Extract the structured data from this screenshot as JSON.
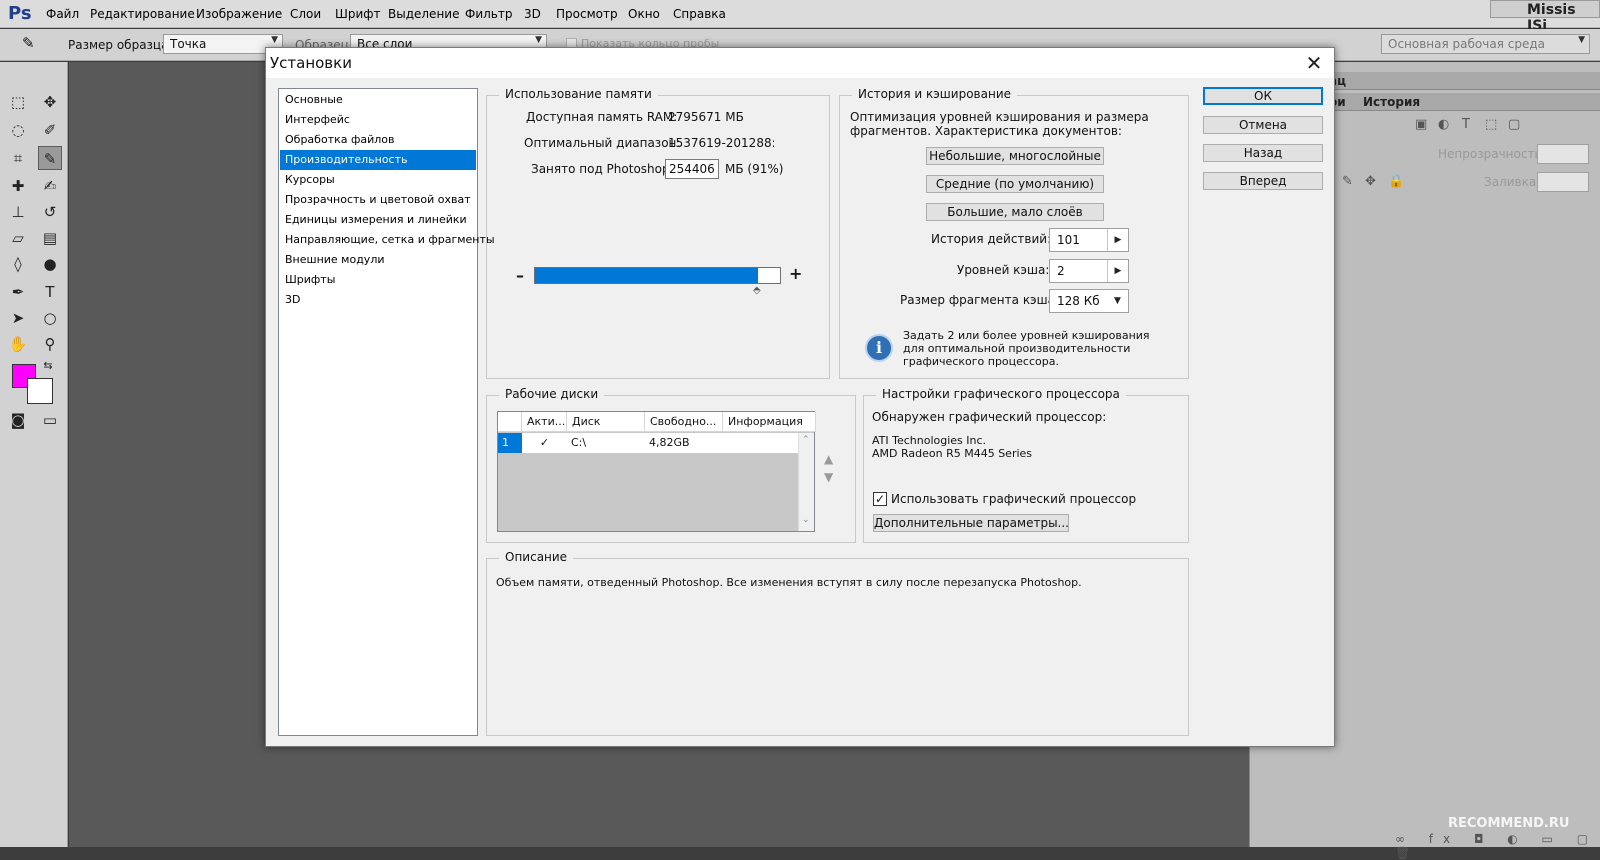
{
  "app": {
    "logo": "Ps",
    "user": "Missis JSi"
  },
  "menu": [
    "Файл",
    "Редактирование",
    "Изображение",
    "Слои",
    "Шрифт",
    "Выделение",
    "Фильтр",
    "3D",
    "Просмотр",
    "Окно",
    "Справка"
  ],
  "options_bar": {
    "sample_size_label": "Размер образца:",
    "sample_size_value": "Точка",
    "sample_label": "Образец:",
    "sample_value": "Все слои",
    "show_ring_label": "Показать кольцо пробы",
    "workspace": "Основная рабочая среда"
  },
  "right_panel": {
    "tab_top": "ац",
    "tab_active_partial": "ои",
    "tab_history": "История",
    "opacity_label": "Непрозрачность:",
    "fill_label": "Заливка:"
  },
  "colors": {
    "foreground": "#ff00ff",
    "background": "#ffffff",
    "selection": "#0078d7"
  },
  "dialog": {
    "title": "Установки",
    "nav": [
      "Основные",
      "Интерфейс",
      "Обработка файлов",
      "Производительность",
      "Курсоры",
      "Прозрачность и цветовой охват",
      "Единицы измерения и линейки",
      "Направляющие, сетка и фрагменты",
      "Внешние модули",
      "Шрифты",
      "3D"
    ],
    "nav_selected_index": 3,
    "buttons": {
      "ok": "ОК",
      "cancel": "Отмена",
      "back": "Назад",
      "forward": "Вперед"
    },
    "memory": {
      "title": "Использование памяти",
      "ram_label": "Доступная память RAM:",
      "ram_value": "2795671 МБ",
      "range_label": "Оптимальный диапазон:",
      "range_value": "1537619-201288:",
      "used_label": "Занято под Photoshop:",
      "used_value": "254406",
      "used_suffix": "МБ (91%)",
      "slider_fraction": 0.91,
      "minus": "–",
      "plus": "+"
    },
    "history_cache": {
      "title": "История и кэширование",
      "description": "Оптимизация уровней кэширования и размера фрагментов. Характеристика документов:",
      "preset_small": "Небольшие, многослойные",
      "preset_medium": "Средние (по умолчанию)",
      "preset_large": "Большие, мало слоёв",
      "history_label": "История действий:",
      "history_value": "101",
      "cache_levels_label": "Уровней кэша:",
      "cache_levels_value": "2",
      "tile_size_label": "Размер фрагмента кэша:",
      "tile_size_value": "128 Кб",
      "info_text": "Задать 2 или более уровней кэширования для оптимальной производительности графического процессора."
    },
    "scratch_disks": {
      "title": "Рабочие диски",
      "columns": [
        "Акти...",
        "Диск",
        "Свободно...",
        "Информация"
      ],
      "rows": [
        {
          "num": "1",
          "active": "✓",
          "disk": "C:\\",
          "free": "4,82GB",
          "info": ""
        }
      ]
    },
    "gpu": {
      "title": "Настройки графического процессора",
      "detected_label": "Обнаружен графический процессор:",
      "vendor": "ATI Technologies Inc.",
      "model": "AMD Radeon R5 M445 Series",
      "use_gpu_label": "Использовать графический процессор",
      "use_gpu_checked": "✓",
      "advanced_button": "Дополнительные параметры..."
    },
    "description": {
      "title": "Описание",
      "text": "Объем памяти, отведенный Photoshop. Все изменения вступят в силу после перезапуска Photoshop."
    }
  },
  "watermark": "RECOMMEND.RU"
}
